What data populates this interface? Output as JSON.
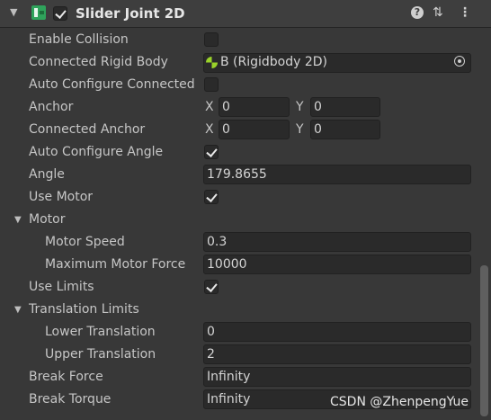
{
  "header": {
    "title": "Slider Joint 2D",
    "enabled": true,
    "icons": [
      "collapse-triangle",
      "slider-joint-2d-icon",
      "help-icon",
      "preset-icon",
      "more-menu-icon"
    ]
  },
  "fields": {
    "enable_collision": {
      "label": "Enable Collision",
      "checked": false
    },
    "connected_rigid_body": {
      "label": "Connected Rigid Body",
      "value": "B (Rigidbody 2D)"
    },
    "auto_configure_connected": {
      "label": "Auto Configure Connected",
      "checked": false
    },
    "anchor": {
      "label": "Anchor",
      "x_label": "X",
      "x": "0",
      "y_label": "Y",
      "y": "0"
    },
    "connected_anchor": {
      "label": "Connected Anchor",
      "x_label": "X",
      "x": "0",
      "y_label": "Y",
      "y": "0"
    },
    "auto_configure_angle": {
      "label": "Auto Configure Angle",
      "checked": true
    },
    "angle": {
      "label": "Angle",
      "value": "179.8655"
    },
    "use_motor": {
      "label": "Use Motor",
      "checked": true
    },
    "motor": {
      "label": "Motor",
      "motor_speed": {
        "label": "Motor Speed",
        "value": "0.3"
      },
      "maximum_motor_force": {
        "label": "Maximum Motor Force",
        "value": "10000"
      }
    },
    "use_limits": {
      "label": "Use Limits",
      "checked": true
    },
    "translation_limits": {
      "label": "Translation Limits",
      "lower_translation": {
        "label": "Lower Translation",
        "value": "0"
      },
      "upper_translation": {
        "label": "Upper Translation",
        "value": "2"
      }
    },
    "break_force": {
      "label": "Break Force",
      "value": "Infinity"
    },
    "break_torque": {
      "label": "Break Torque",
      "value": "Infinity"
    }
  },
  "watermark": "CSDN @ZhenpengYue"
}
